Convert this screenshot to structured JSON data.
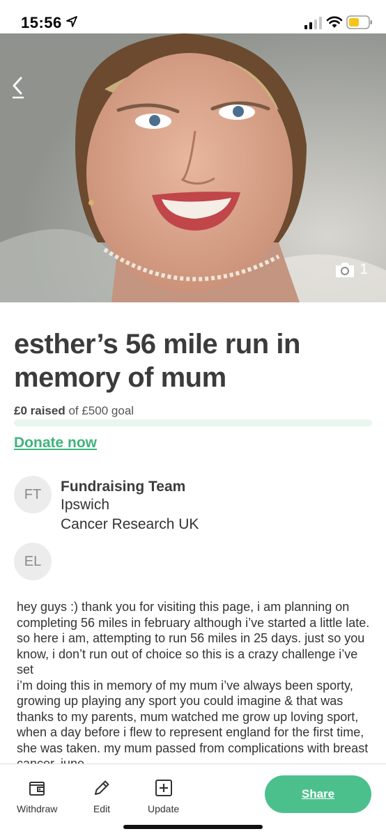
{
  "status_bar": {
    "time": "15:56",
    "icons": [
      "location-arrow-icon",
      "signal-bars-icon",
      "wifi-icon",
      "battery-low-icon"
    ],
    "battery_color": "#f5c518"
  },
  "hero": {
    "back_icon": "chevron-left-icon",
    "photo_icon": "camera-icon",
    "photo_count": "1"
  },
  "page": {
    "title": "esther’s 56 mile run in memory of mum",
    "raised_amount": "£0 raised",
    "goal_text": "of £500 goal",
    "progress_fraction": 0,
    "donate_label": "Donate now"
  },
  "fundraiser": {
    "team_initials": "FT",
    "team_name": "Fundraising Team",
    "team_location": "Ipswich",
    "team_charity": "Cancer Research UK",
    "organiser_initials": "EL"
  },
  "story": {
    "text": "hey guys :) thank you for visiting this page, i am planning on completing 56 miles in february although i’ve started a little late. so here i am, attempting to run 56 miles in 25 days. just so you know, i don’t run out of choice so this is a crazy challenge i’ve set\ni’m doing this in memory of my mum i’ve always been sporty, growing up playing any sport you could imagine & that was thanks to my parents, mum watched me grow up loving sport, when a day before i flew to represent england for the first time, she was taken. my mum passed from complications with breast cancer. june"
  },
  "toolbar": {
    "withdraw_label": "Withdraw",
    "edit_label": "Edit",
    "update_label": "Update",
    "share_label": "Share"
  },
  "colors": {
    "brand_green": "#4cc08c",
    "link_green": "#3fb47b",
    "progress_track": "#e8f6ef"
  }
}
